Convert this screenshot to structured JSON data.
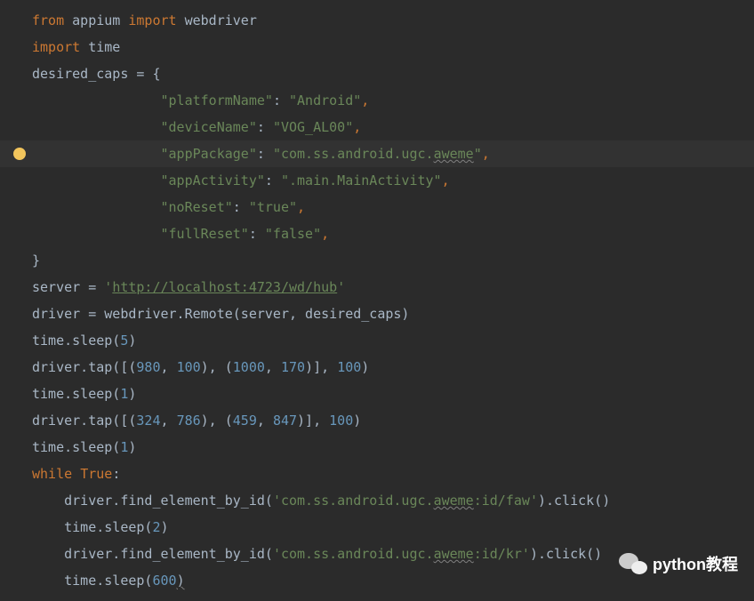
{
  "code": {
    "l1": {
      "from": "from",
      "module": "appium",
      "import": "import",
      "name": "webdriver"
    },
    "l2": {
      "import": "import",
      "name": "time"
    },
    "l3": {
      "var": "desired_caps",
      "eq": " = ",
      "brace": "{"
    },
    "l4": {
      "key": "\"platformName\"",
      "colon": ": ",
      "val": "\"Android\"",
      "comma": ","
    },
    "l5": {
      "key": "\"deviceName\"",
      "colon": ": ",
      "val": "\"VOG_AL00\"",
      "comma": ","
    },
    "l6": {
      "key": "\"appPackage\"",
      "colon": ": ",
      "valPrefix": "\"com.ss.android.ugc.",
      "valWavy": "aweme",
      "valSuffix": "\"",
      "comma": ","
    },
    "l7": {
      "key": "\"appActivity\"",
      "colon": ": ",
      "val": "\".main.MainActivity\"",
      "comma": ","
    },
    "l8": {
      "key": "\"noReset\"",
      "colon": ": ",
      "val": "\"true\"",
      "comma": ","
    },
    "l9": {
      "key": "\"fullReset\"",
      "colon": ": ",
      "val": "\"false\"",
      "comma": ","
    },
    "l10": {
      "brace": "}"
    },
    "l11": {
      "var": "server",
      "eq": " = ",
      "q1": "'",
      "url": "http://localhost:4723/wd/hub",
      "q2": "'"
    },
    "l12": {
      "text": "driver = webdriver.Remote(server, desired_caps)"
    },
    "l13": {
      "prefix": "time.sleep(",
      "num": "5",
      "suffix": ")"
    },
    "l14": {
      "p1": "driver.tap([(",
      "n1": "980",
      "c1": ", ",
      "n2": "100",
      "p2": "), (",
      "n3": "1000",
      "c2": ", ",
      "n4": "170",
      "p3": ")], ",
      "n5": "100",
      "p4": ")"
    },
    "l15": {
      "prefix": "time.sleep(",
      "num": "1",
      "suffix": ")"
    },
    "l16": {
      "p1": "driver.tap([(",
      "n1": "324",
      "c1": ", ",
      "n2": "786",
      "p2": "), (",
      "n3": "459",
      "c2": ", ",
      "n4": "847",
      "p3": ")], ",
      "n5": "100",
      "p4": ")"
    },
    "l17": {
      "prefix": "time.sleep(",
      "num": "1",
      "suffix": ")"
    },
    "l18": {
      "while": "while",
      "sp": " ",
      "true": "True",
      "colon": ":"
    },
    "l19": {
      "p1": "    driver.find_element_by_id(",
      "q1": "'",
      "s1": "com.ss.android.ugc.",
      "wavy": "aweme",
      "s2": ":id/faw",
      "q2": "'",
      "p2": ").click()"
    },
    "l20": {
      "prefix": "    time.sleep(",
      "num": "2",
      "suffix": ")"
    },
    "l21": {
      "p1": "    driver.find_element_by_id(",
      "q1": "'",
      "s1": "com.ss.android.ugc.",
      "wavy": "aweme",
      "s2": ":id/kr",
      "q2": "'",
      "p2": ").click()"
    },
    "l22": {
      "prefix": "    time.sleep(",
      "num": "600",
      "suffix": ")"
    }
  },
  "watermark": "python教程"
}
